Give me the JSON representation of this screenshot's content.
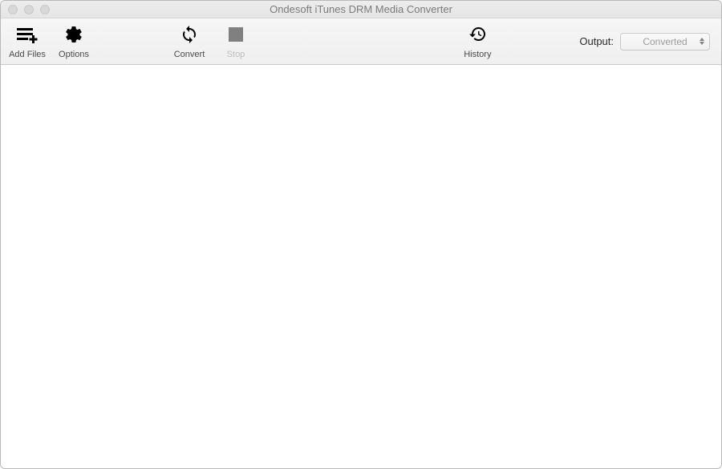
{
  "window": {
    "title": "Ondesoft iTunes DRM Media Converter"
  },
  "toolbar": {
    "add_files_label": "Add Files",
    "options_label": "Options",
    "convert_label": "Convert",
    "stop_label": "Stop",
    "history_label": "History"
  },
  "output": {
    "label": "Output:",
    "selected": "Converted"
  }
}
